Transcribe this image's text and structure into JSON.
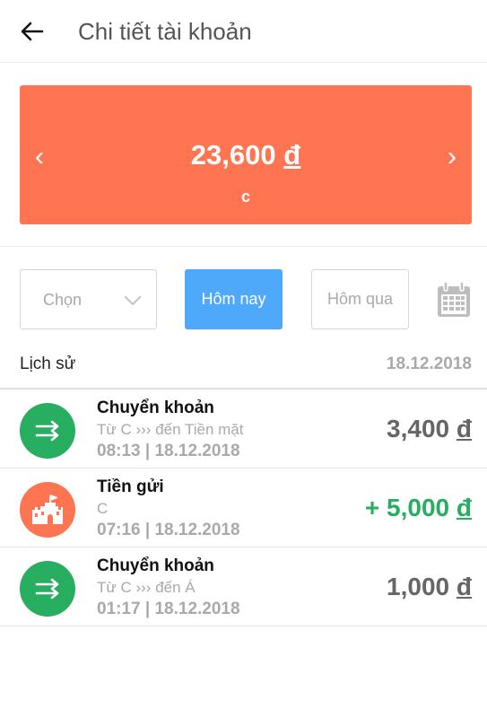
{
  "header": {
    "title": "Chi tiết tài khoản"
  },
  "balance": {
    "amount": "23,600",
    "currency_symbol": "đ",
    "account_name": "c",
    "prev_arrow": "‹",
    "next_arrow": "›"
  },
  "filters": {
    "select_label": "Chọn",
    "today_label": "Hôm nay",
    "yesterday_label": "Hôm qua"
  },
  "history": {
    "label": "Lịch sử",
    "date": "18.12.2018",
    "items": [
      {
        "icon": "transfer-icon",
        "title": "Chuyển khoản",
        "description": "Từ C ››› đến Tiền mặt",
        "time": "08:13 | 18.12.2018",
        "amount": "3,400",
        "currency": "đ"
      },
      {
        "icon": "castle-icon",
        "title": "Tiền gửi",
        "description": "C",
        "time": "07:16 | 18.12.2018",
        "amount": "+ 5,000",
        "currency": "đ"
      },
      {
        "icon": "transfer-icon",
        "title": "Chuyển khoản",
        "description": "Từ C ››› đến Á",
        "time": "01:17 | 18.12.2018",
        "amount": "1,000",
        "currency": "đ"
      }
    ]
  },
  "colors": {
    "accent": "#ff7451",
    "primary_blue": "#4ea9fb",
    "positive_green": "#27ae60",
    "muted": "#a9a9a9"
  }
}
